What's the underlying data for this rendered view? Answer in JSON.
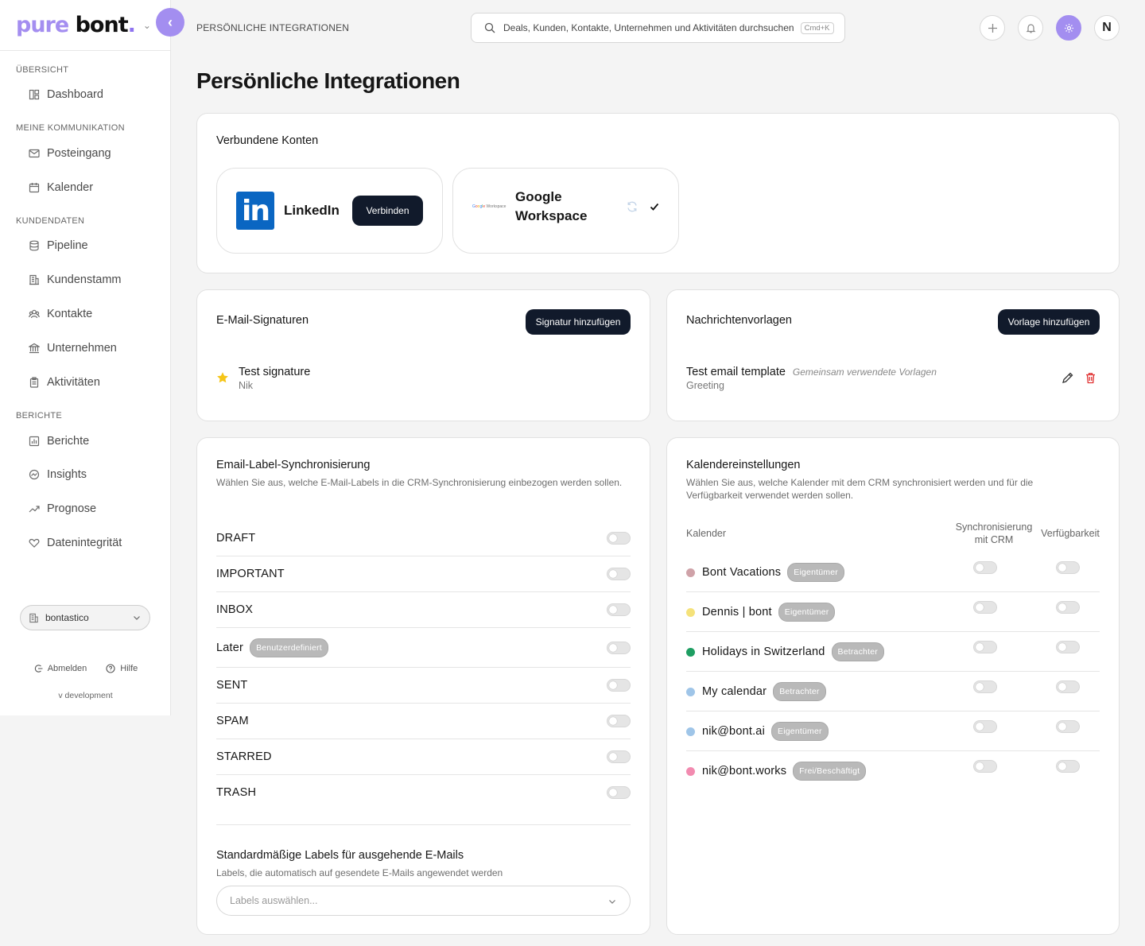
{
  "brand": {
    "logo_pure": "pure",
    "logo_bont": "bont",
    "logo_dot": ".",
    "accent": "#a38ef0"
  },
  "sidebar": {
    "sections": [
      {
        "label": "ÜBERSICHT"
      },
      {
        "label": "MEINE KOMMUNIKATION"
      },
      {
        "label": "KUNDENDATEN"
      },
      {
        "label": "BERICHTE"
      }
    ],
    "items": [
      {
        "label": "Dashboard",
        "icon": "dashboard-icon"
      },
      {
        "label": "Posteingang",
        "icon": "mail-icon"
      },
      {
        "label": "Kalender",
        "icon": "calendar-icon"
      },
      {
        "label": "Pipeline",
        "icon": "database-icon"
      },
      {
        "label": "Kundenstamm",
        "icon": "building-icon"
      },
      {
        "label": "Kontakte",
        "icon": "contacts-icon"
      },
      {
        "label": "Unternehmen",
        "icon": "bank-icon"
      },
      {
        "label": "Aktivitäten",
        "icon": "clipboard-icon"
      },
      {
        "label": "Berichte",
        "icon": "bar-chart-icon"
      },
      {
        "label": "Insights",
        "icon": "gauge-icon"
      },
      {
        "label": "Prognose",
        "icon": "trend-icon"
      },
      {
        "label": "Datenintegrität",
        "icon": "heart-icon"
      }
    ],
    "org": "bontastico",
    "logout": "Abmelden",
    "help": "Hilfe",
    "version": "v development"
  },
  "header": {
    "breadcrumb": "PERSÖNLICHE INTEGRATIONEN",
    "search_placeholder": "Deals, Kunden, Kontakte, Unternehmen und Aktivitäten durchsuchen",
    "search_shortcut": "Cmd+K",
    "avatar_initial": "N"
  },
  "page_title": "Persönliche Integrationen",
  "connected": {
    "title": "Verbundene Konten",
    "linkedin": {
      "logo": "in",
      "name": "LinkedIn",
      "button": "Verbinden"
    },
    "google": {
      "name_line1": "Google",
      "name_line2": "Workspace",
      "logo_text": "Google Workspace"
    }
  },
  "signatures": {
    "title": "E-Mail-Signaturen",
    "add_button": "Signatur hinzufügen",
    "items": [
      {
        "name": "Test signature",
        "owner": "Nik"
      }
    ]
  },
  "templates": {
    "title": "Nachrichtenvorlagen",
    "add_button": "Vorlage hinzufügen",
    "items": [
      {
        "name": "Test email template",
        "tag": "Gemeinsam verwendete Vorlagen",
        "sub": "Greeting"
      }
    ]
  },
  "label_sync": {
    "title": "Email-Label-Synchronisierung",
    "subtitle": "Wählen Sie aus, welche E-Mail-Labels in die CRM-Synchronisierung einbezogen werden sollen.",
    "labels": [
      {
        "name": "DRAFT",
        "badge": null
      },
      {
        "name": "IMPORTANT",
        "badge": null
      },
      {
        "name": "INBOX",
        "badge": null
      },
      {
        "name": "Later",
        "badge": "Benutzerdefiniert"
      },
      {
        "name": "SENT",
        "badge": null
      },
      {
        "name": "SPAM",
        "badge": null
      },
      {
        "name": "STARRED",
        "badge": null
      },
      {
        "name": "TRASH",
        "badge": null
      }
    ],
    "outgoing_title": "Standardmäßige Labels für ausgehende E-Mails",
    "outgoing_subtitle": "Labels, die automatisch auf gesendete E-Mails angewendet werden",
    "outgoing_placeholder": "Labels auswählen..."
  },
  "calendar_settings": {
    "title": "Kalendereinstellungen",
    "subtitle": "Wählen Sie aus, welche Kalender mit dem CRM synchronisiert werden und für die Verfügbarkeit verwendet werden sollen.",
    "col_calendar": "Kalender",
    "col_sync_line1": "Synchronisierung",
    "col_sync_line2": "mit CRM",
    "col_availability": "Verfügbarkeit",
    "calendars": [
      {
        "name": "Bont Vacations",
        "role": "Eigentümer",
        "color": "#cfa2a8"
      },
      {
        "name": "Dennis | bont",
        "role": "Eigentümer",
        "color": "#f5e27a"
      },
      {
        "name": "Holidays in Switzerland",
        "role": "Betrachter",
        "color": "#1e9e62"
      },
      {
        "name": "My calendar",
        "role": "Betrachter",
        "color": "#9fc5e8"
      },
      {
        "name": "nik@bont.ai",
        "role": "Eigentümer",
        "color": "#9fc5e8"
      },
      {
        "name": "nik@bont.works",
        "role": "Frei/Beschäftigt",
        "color": "#f28bb0"
      }
    ]
  }
}
